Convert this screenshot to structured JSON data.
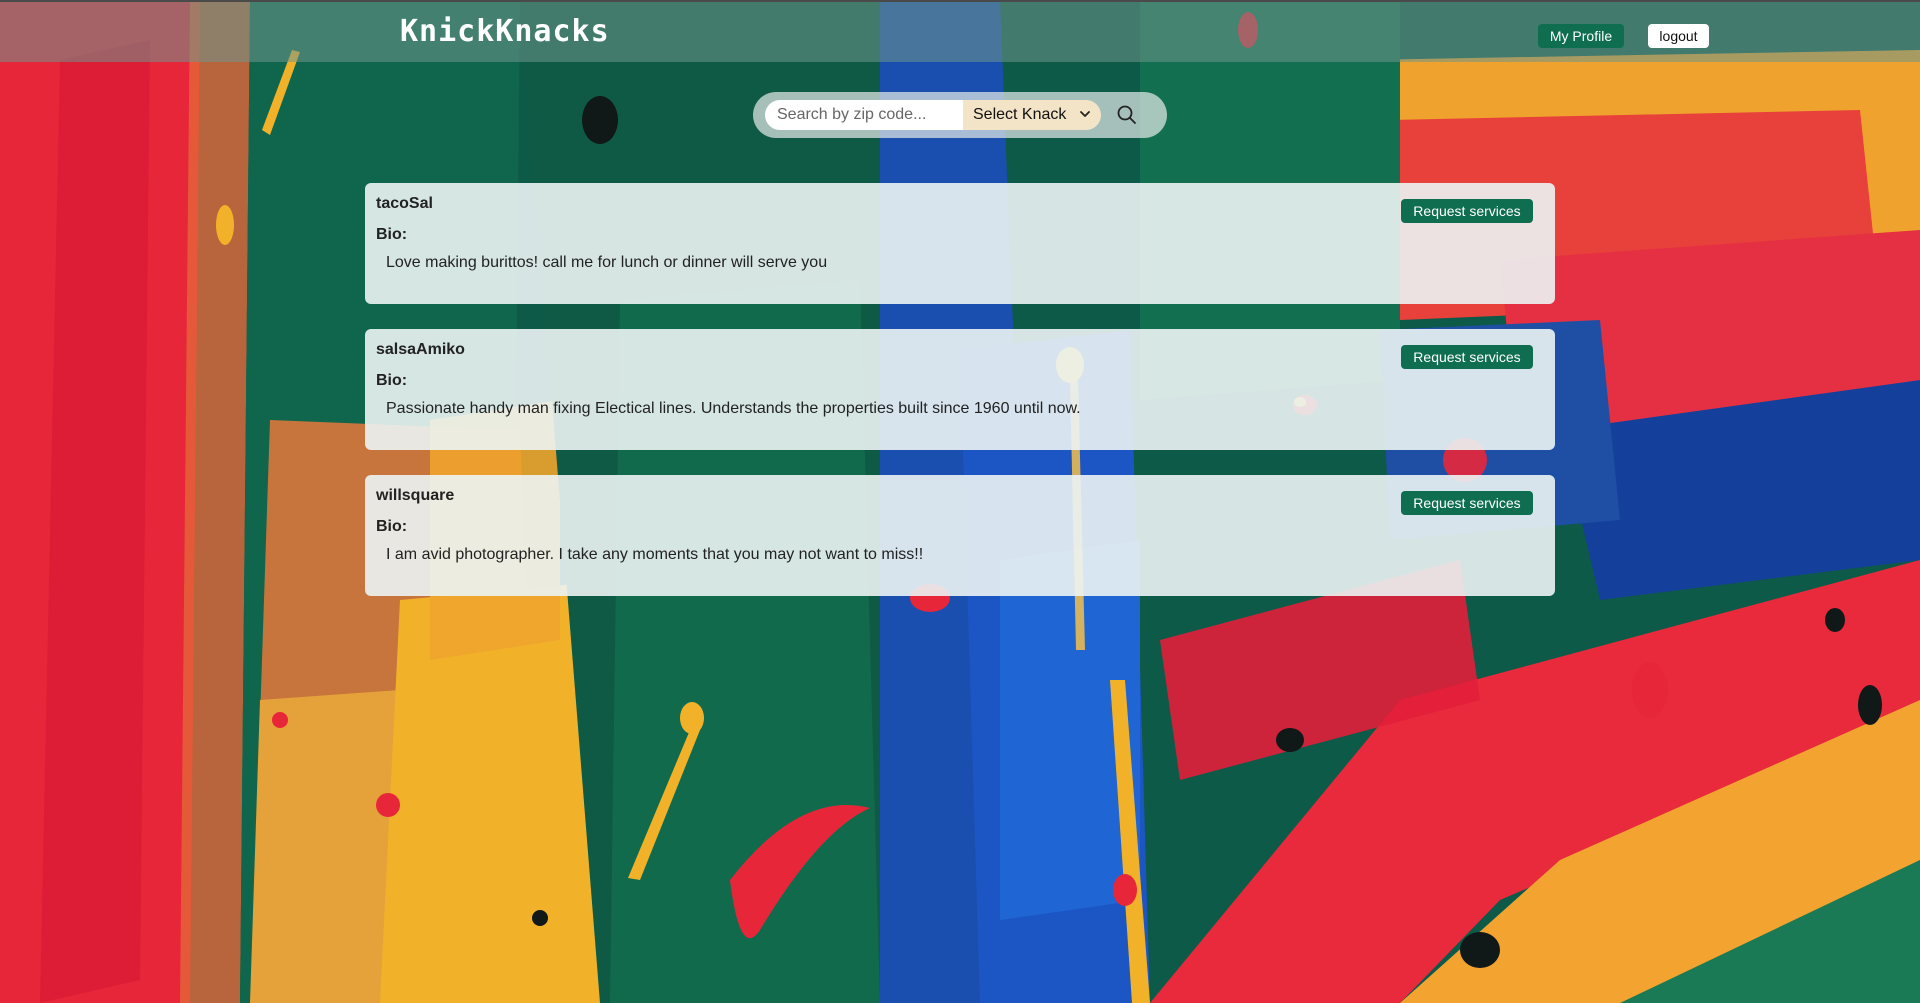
{
  "header": {
    "brand": "KnickKnacks",
    "profile_label": "My Profile",
    "logout_label": "logout"
  },
  "search": {
    "placeholder": "Search by zip code...",
    "value": "",
    "select_value": "Select Knack"
  },
  "providers": [
    {
      "username": "tacoSal",
      "bio_label": "Bio:",
      "bio": "Love making burittos! call me for lunch or dinner will serve you",
      "action_label": "Request services"
    },
    {
      "username": "salsaAmiko",
      "bio_label": "Bio:",
      "bio": "Passionate handy man fixing Electical lines. Understands the properties built since 1960 until now.",
      "action_label": "Request services"
    },
    {
      "username": "willsquare",
      "bio_label": "Bio:",
      "bio": "I am avid photographer. I take any moments that you may not want to miss!!",
      "action_label": "Request services"
    }
  ],
  "colors": {
    "accent": "#0f6e4f",
    "card_bg": "#ecf4f4",
    "select_bg": "#f3e4c8"
  },
  "icons": {
    "search": "search-icon",
    "select": "chevron-down-icon"
  }
}
